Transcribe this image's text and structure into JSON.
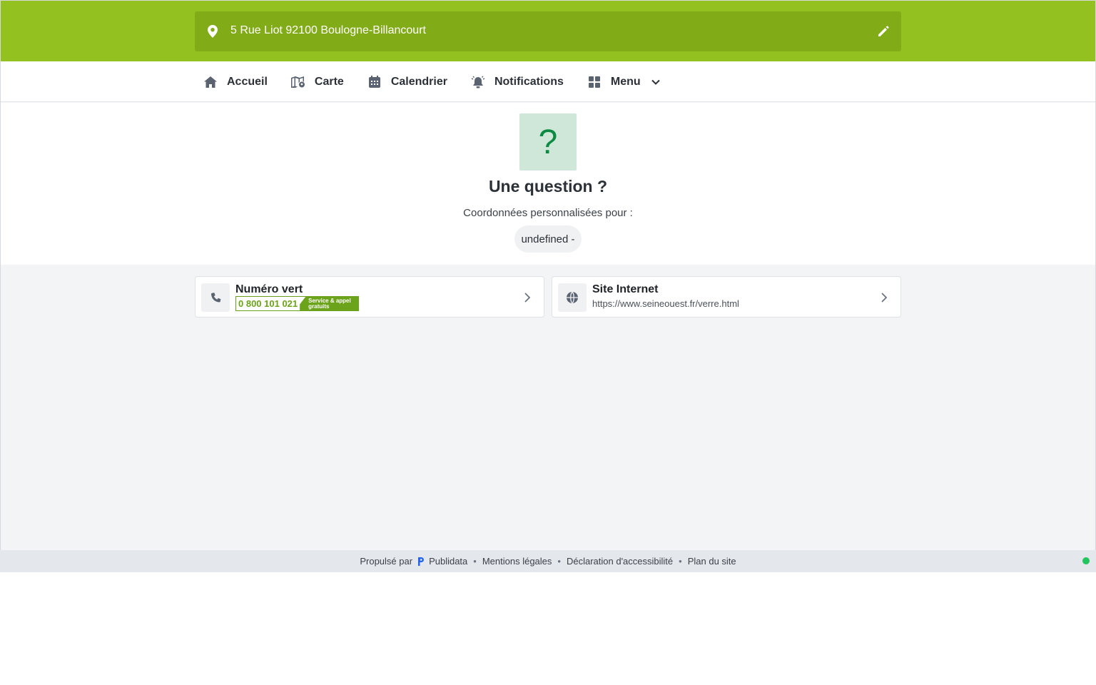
{
  "header": {
    "address": "5 Rue Liot 92100 Boulogne-Billancourt",
    "accent_color": "#93c11f"
  },
  "nav": {
    "items": [
      {
        "label": "Accueil",
        "icon": "home-icon"
      },
      {
        "label": "Carte",
        "icon": "map-icon"
      },
      {
        "label": "Calendrier",
        "icon": "calendar-icon"
      },
      {
        "label": "Notifications",
        "icon": "bell-icon"
      },
      {
        "label": "Menu",
        "icon": "grid-icon"
      }
    ]
  },
  "hero": {
    "icon_glyph": "?",
    "title": "Une question ?",
    "subtitle": "Coordonnées personnalisées pour :",
    "pill": "undefined -"
  },
  "cards": {
    "phone": {
      "title": "Numéro vert",
      "number": "0 800 101 021",
      "badge_line1": "Service & appel",
      "badge_line2": "gratuits"
    },
    "website": {
      "title": "Site Internet",
      "url": "https://www.seineouest.fr/verre.html"
    }
  },
  "footer": {
    "powered_by": "Propulsé par",
    "brand": "Publidata",
    "links": [
      "Mentions légales",
      "Déclaration d'accessibilité",
      "Plan du site"
    ],
    "separator": "•"
  }
}
